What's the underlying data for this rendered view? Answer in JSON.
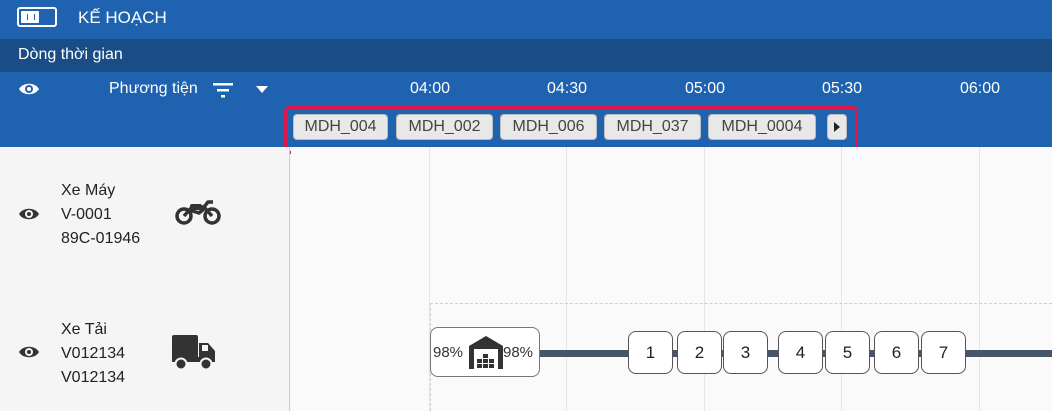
{
  "app": {
    "title": "KẾ HOẠCH"
  },
  "sidebar": {
    "timeline_title": "Dòng thời gian",
    "vehicle_column_label": "Phương tiện"
  },
  "timeline": {
    "ticks": [
      "04:00",
      "04:30",
      "05:00",
      "05:30",
      "06:00"
    ]
  },
  "orders": [
    "MDH_004",
    "MDH_002",
    "MDH_006",
    "MDH_037",
    "MDH_0004"
  ],
  "vehicles": [
    {
      "type": "Xe Máy",
      "code": "V-0001",
      "plate": "89C-01946",
      "icon": "motorcycle-icon"
    },
    {
      "type": "Xe Tải",
      "code": "V012134",
      "plate": "V012134",
      "icon": "truck-icon"
    }
  ],
  "route": {
    "depot_load_left": "98%",
    "depot_load_right": "98%",
    "stops": [
      "1",
      "2",
      "3",
      "4",
      "5",
      "6",
      "7"
    ]
  },
  "colors": {
    "header_blue": "#1f63b0",
    "header_dark_blue": "#1a4d86",
    "highlight_red": "#e0164b",
    "route_line": "#475569"
  }
}
